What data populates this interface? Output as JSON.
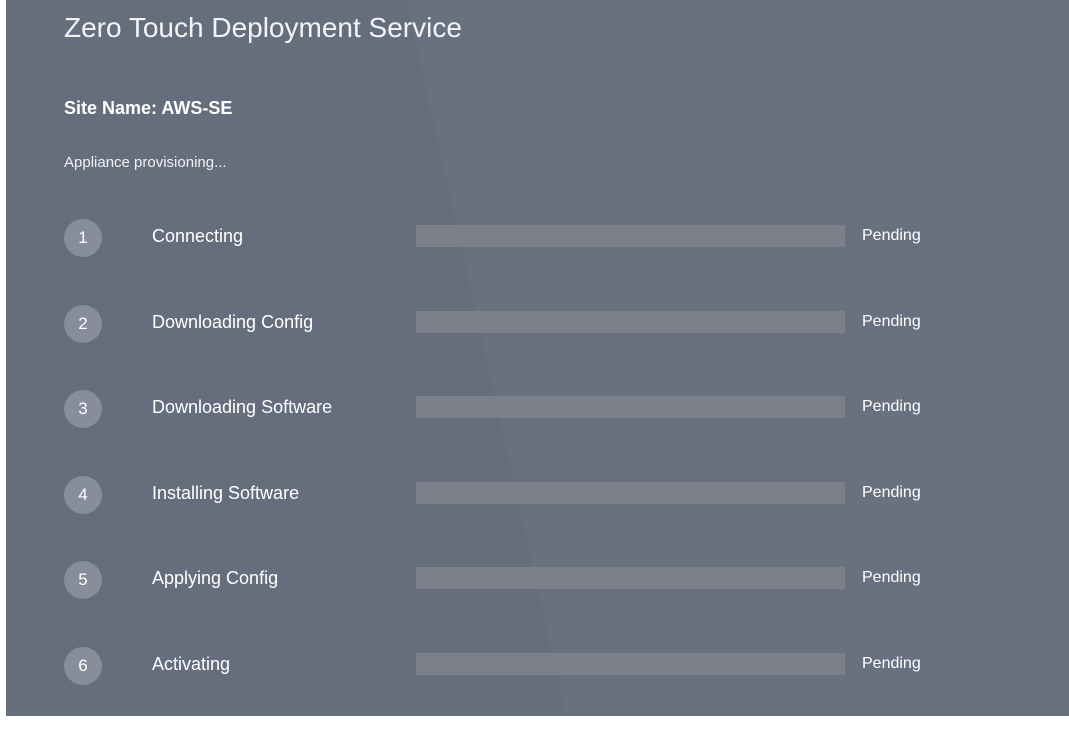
{
  "header": {
    "title": "Zero Touch Deployment Service",
    "site_name": "Site Name: AWS-SE",
    "status_message": "Appliance provisioning..."
  },
  "steps": [
    {
      "number": "1",
      "label": "Connecting",
      "status": "Pending",
      "progress": 0
    },
    {
      "number": "2",
      "label": "Downloading Config",
      "status": "Pending",
      "progress": 0
    },
    {
      "number": "3",
      "label": "Downloading Software",
      "status": "Pending",
      "progress": 0
    },
    {
      "number": "4",
      "label": "Installing Software",
      "status": "Pending",
      "progress": 0
    },
    {
      "number": "5",
      "label": "Applying Config",
      "status": "Pending",
      "progress": 0
    },
    {
      "number": "6",
      "label": "Activating",
      "status": "Pending",
      "progress": 0
    }
  ],
  "colors": {
    "background": "#666e7e",
    "step_circle": "#878d9b",
    "progress_track": "#7c808a",
    "text": "#ffffff"
  }
}
